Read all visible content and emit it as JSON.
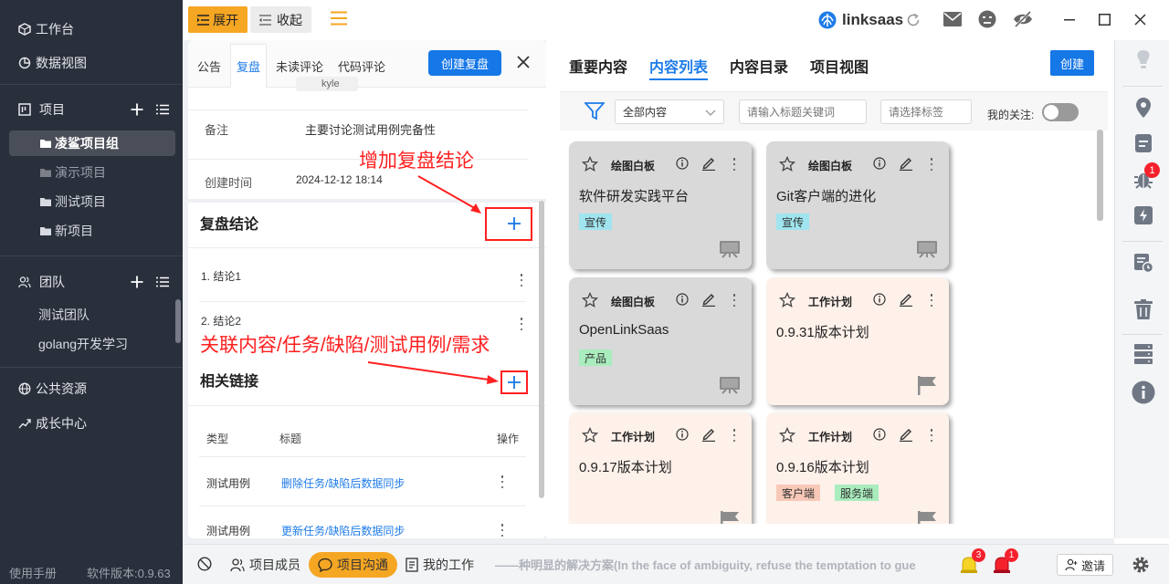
{
  "sidebar": {
    "workbench": "工作台",
    "data_view": "数据视图",
    "projects_header": "项目",
    "projects": [
      "凌鲨项目组",
      "演示项目",
      "测试项目",
      "新项目"
    ],
    "team_header": "团队",
    "teams": [
      "测试团队",
      "golang开发学习"
    ],
    "public_resources": "公共资源",
    "growth_center": "成长中心",
    "manual": "使用手册",
    "version": "软件版本:0.9.63"
  },
  "topbar": {
    "expand": "展开",
    "collapse": "收起",
    "brand": "linksaas"
  },
  "leftpanel": {
    "tabs": [
      "公告",
      "复盘",
      "未读评论",
      "代码评论"
    ],
    "create_button": "创建复盘",
    "partial_user": "kyle",
    "remark_label": "备注",
    "remark_value": "主要讨论测试用例完备性",
    "created_label": "创建时间",
    "created_value": "2024-12-12 18:14",
    "conclusion_title": "复盘结论",
    "conclusions": [
      "1.  结论1",
      "2.  结论2"
    ],
    "links_title": "相关链接",
    "links_headers": [
      "类型",
      "标题",
      "操作"
    ],
    "links_rows": [
      {
        "type": "测试用例",
        "title": "删除任务/缺陷后数据同步"
      },
      {
        "type": "测试用例",
        "title": "更新任务/缺陷后数据同步"
      }
    ]
  },
  "annotations": {
    "add_conclusion": "增加复盘结论",
    "link_items": "关联内容/任务/缺陷/测试用例/需求"
  },
  "middle": {
    "tabs": [
      "重要内容",
      "内容列表",
      "内容目录",
      "项目视图"
    ],
    "create_button": "创建",
    "filter": {
      "select_value": "全部内容",
      "keyword_placeholder": "请输入标题关键词",
      "tag_placeholder": "请选择标签",
      "watch_label": "我的关注:"
    },
    "cards": [
      {
        "type": "绘图白板",
        "title": "软件研发实践平台",
        "tags": [
          {
            "text": "宣传",
            "color": "cyan"
          }
        ],
        "bg": "gray",
        "icon": "whiteboard-icon"
      },
      {
        "type": "绘图白板",
        "title": "Git客户端的进化",
        "tags": [
          {
            "text": "宣传",
            "color": "cyan"
          }
        ],
        "bg": "gray",
        "icon": "whiteboard-icon"
      },
      {
        "type": "绘图白板",
        "title": "OpenLinkSaas",
        "tags": [
          {
            "text": "产品",
            "color": "green"
          }
        ],
        "bg": "gray",
        "icon": "whiteboard-icon"
      },
      {
        "type": "工作计划",
        "title": "0.9.31版本计划",
        "tags": [],
        "bg": "peach",
        "icon": "flag-icon"
      },
      {
        "type": "工作计划",
        "title": "0.9.17版本计划",
        "tags": [],
        "bg": "peach",
        "icon": "flag-icon"
      },
      {
        "type": "工作计划",
        "title": "0.9.16版本计划",
        "tags": [
          {
            "text": "客户端",
            "color": "pink"
          },
          {
            "text": "服务端",
            "color": "green"
          }
        ],
        "bg": "peach",
        "icon": "flag-icon"
      }
    ]
  },
  "rightbar": {
    "bug_badge": "1"
  },
  "bottombar": {
    "members": "项目成员",
    "chat": "项目沟通",
    "my_work": "我的工作",
    "marquee": "——种明显的解决方案(In the face of ambiguity, refuse the temptation to gue",
    "alarm_badge_1": "3",
    "alarm_badge_2": "1",
    "invite": "邀请"
  },
  "colors": {
    "sidebar_bg": "#2a2f3c",
    "accent": "#1677e6",
    "top_highlight": "#f5a623",
    "annotation_red": "#ff2020"
  }
}
